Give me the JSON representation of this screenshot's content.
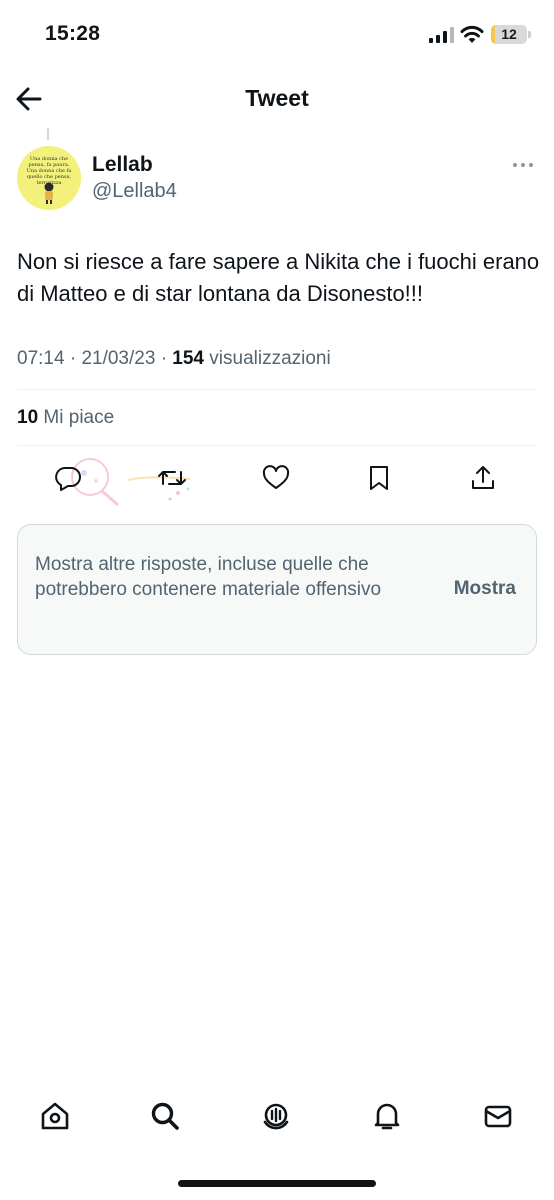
{
  "status_bar": {
    "time": "15:28",
    "battery": "12"
  },
  "header": {
    "title": "Tweet",
    "back_icon": "arrow-left-icon"
  },
  "tweet": {
    "display_name": "Lellab",
    "handle": "@Lellab4",
    "text": "Non si riesce a fare sapere a Nikita che i fuochi erano di Matteo e di star lontana da Disonesto!!!",
    "time": "07:14",
    "date": "21/03/23",
    "separator": "·",
    "views_count": "154",
    "views_label": "visualizzazioni",
    "likes_count": "10",
    "likes_label": "Mi piace",
    "avatar_text": "Una donna che pensa, fa paura. Una donna che fa quello che pensa, terrorizza"
  },
  "actions": [
    {
      "name": "reply",
      "icon": "comment-icon"
    },
    {
      "name": "retweet",
      "icon": "retweet-icon"
    },
    {
      "name": "like",
      "icon": "heart-icon"
    },
    {
      "name": "bookmark",
      "icon": "bookmark-icon"
    },
    {
      "name": "share",
      "icon": "share-icon"
    }
  ],
  "notice": {
    "text": "Mostra altre risposte, incluse quelle che potrebbero contenere materiale offensivo",
    "button": "Mostra"
  },
  "tabbar": [
    {
      "name": "home",
      "icon": "home-icon"
    },
    {
      "name": "search",
      "icon": "search-icon"
    },
    {
      "name": "spaces",
      "icon": "spaces-icon"
    },
    {
      "name": "notifications",
      "icon": "bell-icon"
    },
    {
      "name": "messages",
      "icon": "mail-icon"
    }
  ],
  "colors": {
    "text_primary": "#0f1419",
    "text_secondary": "#536471",
    "border": "#cfd9de",
    "notice_bg": "#f7f9f9",
    "battery_fill": "#f2c94c"
  }
}
